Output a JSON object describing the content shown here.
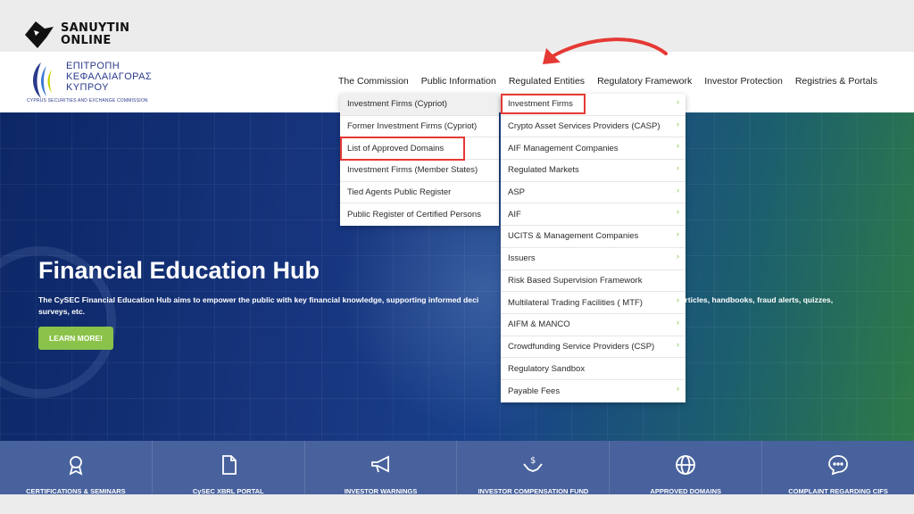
{
  "watermark": {
    "line1": "SANUYTIN",
    "line2": "ONLINE"
  },
  "logo": {
    "line1": "ΕΠΙΤΡΟΠΗ",
    "line2": "ΚΕΦΑΛΑΙΑΓΟΡΑΣ",
    "line3": "ΚΥΠΡΟΥ",
    "subtitle": "CYPRUS SECURITIES AND EXCHANGE COMMISSION"
  },
  "nav": [
    "The Commission",
    "Public Information",
    "Regulated Entities",
    "Regulatory Framework",
    "Investor Protection",
    "Registries & Portals"
  ],
  "menu_left": [
    "Investment Firms (Cypriot)",
    "Former Investment Firms (Cypriot)",
    "List of Approved Domains",
    "Investment Firms (Member States)",
    "Tied Agents Public Register",
    "Public Register of Certified Persons"
  ],
  "menu_right": [
    "Investment Firms",
    "Crypto Asset Services Providers (CASP)",
    "AIF Management Companies",
    "Regulated Markets",
    "ASP",
    "AIF",
    "UCITS & Management Companies",
    "Issuers",
    "Risk Based Supervision Framework",
    "Multilateral Trading Facilities ( MTF)",
    "AIFM & MANCO",
    "Crowdfunding Service Providers (CSP)",
    "Regulatory Sandbox",
    "Payable Fees"
  ],
  "hero": {
    "title": "Financial Education Hub",
    "description": "The CySEC Financial Education Hub aims to empower the public with key financial knowledge, supporting informed deci",
    "description_tail": "es, articles, handbooks, fraud alerts, quizzes,",
    "description_line2": "surveys, etc.",
    "cta": "LEARN MORE!"
  },
  "band": [
    {
      "label": "CERTIFICATIONS & SEMINARS",
      "icon": "certificate-icon"
    },
    {
      "label": "CySEC XBRL PORTAL",
      "icon": "document-icon"
    },
    {
      "label": "INVESTOR WARNINGS",
      "icon": "megaphone-icon"
    },
    {
      "label": "INVESTOR COMPENSATION FUND",
      "icon": "hands-money-icon"
    },
    {
      "label": "APPROVED DOMAINS",
      "icon": "globe-icon"
    },
    {
      "label": "COMPLAINT REGARDING CIFS",
      "icon": "chat-icon"
    }
  ],
  "colors": {
    "accent_green": "#8bc34a",
    "highlight_red": "#e53935",
    "brand_blue": "#2b3a8a"
  }
}
